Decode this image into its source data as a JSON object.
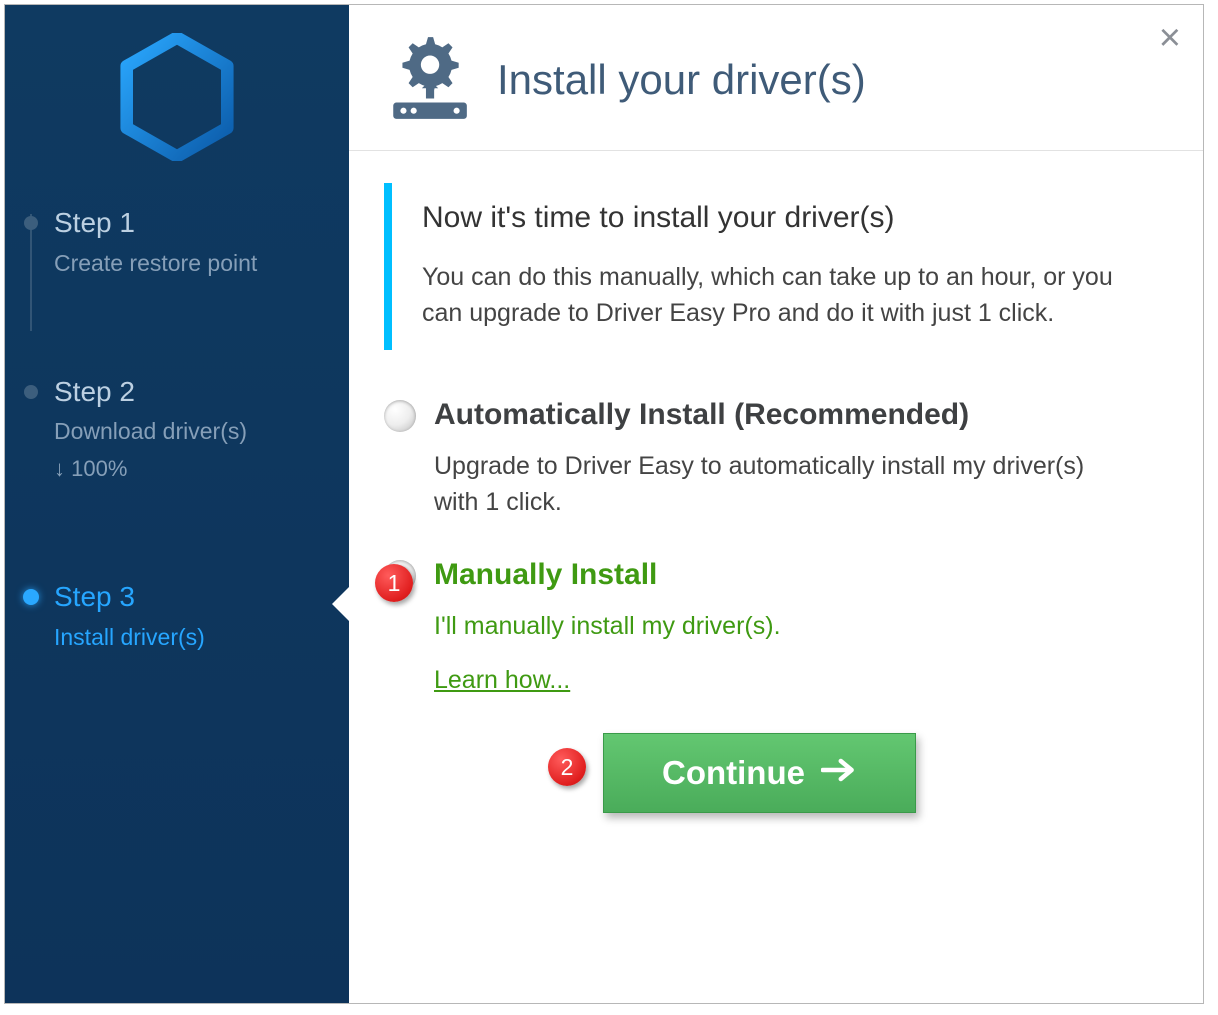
{
  "sidebar": {
    "steps": [
      {
        "title": "Step 1",
        "sub": "Create restore point"
      },
      {
        "title": "Step 2",
        "sub": "Download driver(s)",
        "extra": "↓ 100%"
      },
      {
        "title": "Step 3",
        "sub": "Install driver(s)"
      }
    ]
  },
  "header": {
    "title": "Install your driver(s)"
  },
  "callout": {
    "title": "Now it's time to install your driver(s)",
    "text": "You can do this manually, which can take up to an hour, or you can upgrade to Driver Easy Pro and do it with just 1 click."
  },
  "options": {
    "auto": {
      "title": "Automatically Install (Recommended)",
      "desc": "Upgrade to Driver Easy to automatically install my driver(s) with 1 click."
    },
    "manual": {
      "title": "Manually Install",
      "desc": "I'll manually install my driver(s).",
      "learn": "Learn how..."
    }
  },
  "badges": {
    "one": "1",
    "two": "2"
  },
  "continue_label": "Continue"
}
